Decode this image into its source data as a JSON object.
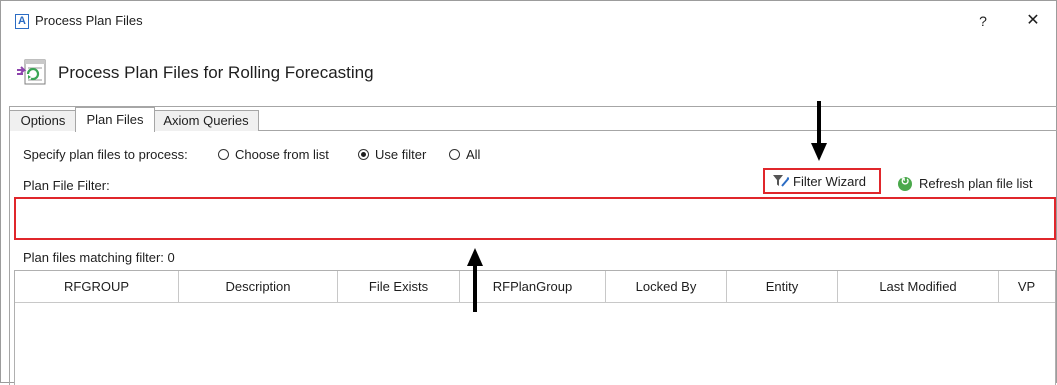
{
  "window": {
    "app_icon": "A",
    "title": "Process Plan Files",
    "help_label": "?",
    "close_label": "✕"
  },
  "header": {
    "icon": "process-plan-files-icon",
    "title": "Process Plan Files for Rolling Forecasting"
  },
  "tabs": [
    {
      "label": "Options",
      "active": false
    },
    {
      "label": "Plan Files",
      "active": true
    },
    {
      "label": "Axiom Queries",
      "active": false
    }
  ],
  "spec": {
    "label": "Specify plan files to process:",
    "options": [
      {
        "label": "Choose from list",
        "selected": false
      },
      {
        "label": "Use filter",
        "selected": true
      },
      {
        "label": "All",
        "selected": false
      }
    ]
  },
  "filter": {
    "label": "Plan File Filter:",
    "value": "",
    "wizard_label": "Filter Wizard",
    "refresh_label": "Refresh plan file list"
  },
  "matching": {
    "label": "Plan files matching filter: 0"
  },
  "grid": {
    "columns": [
      "RFGROUP",
      "Description",
      "File Exists",
      "RFPlanGroup",
      "Locked By",
      "Entity",
      "Last Modified",
      "VP"
    ]
  },
  "colors": {
    "highlight": "#e0262b",
    "refresh_icon": "#4aa84b",
    "accent": "#2b6cc4"
  }
}
